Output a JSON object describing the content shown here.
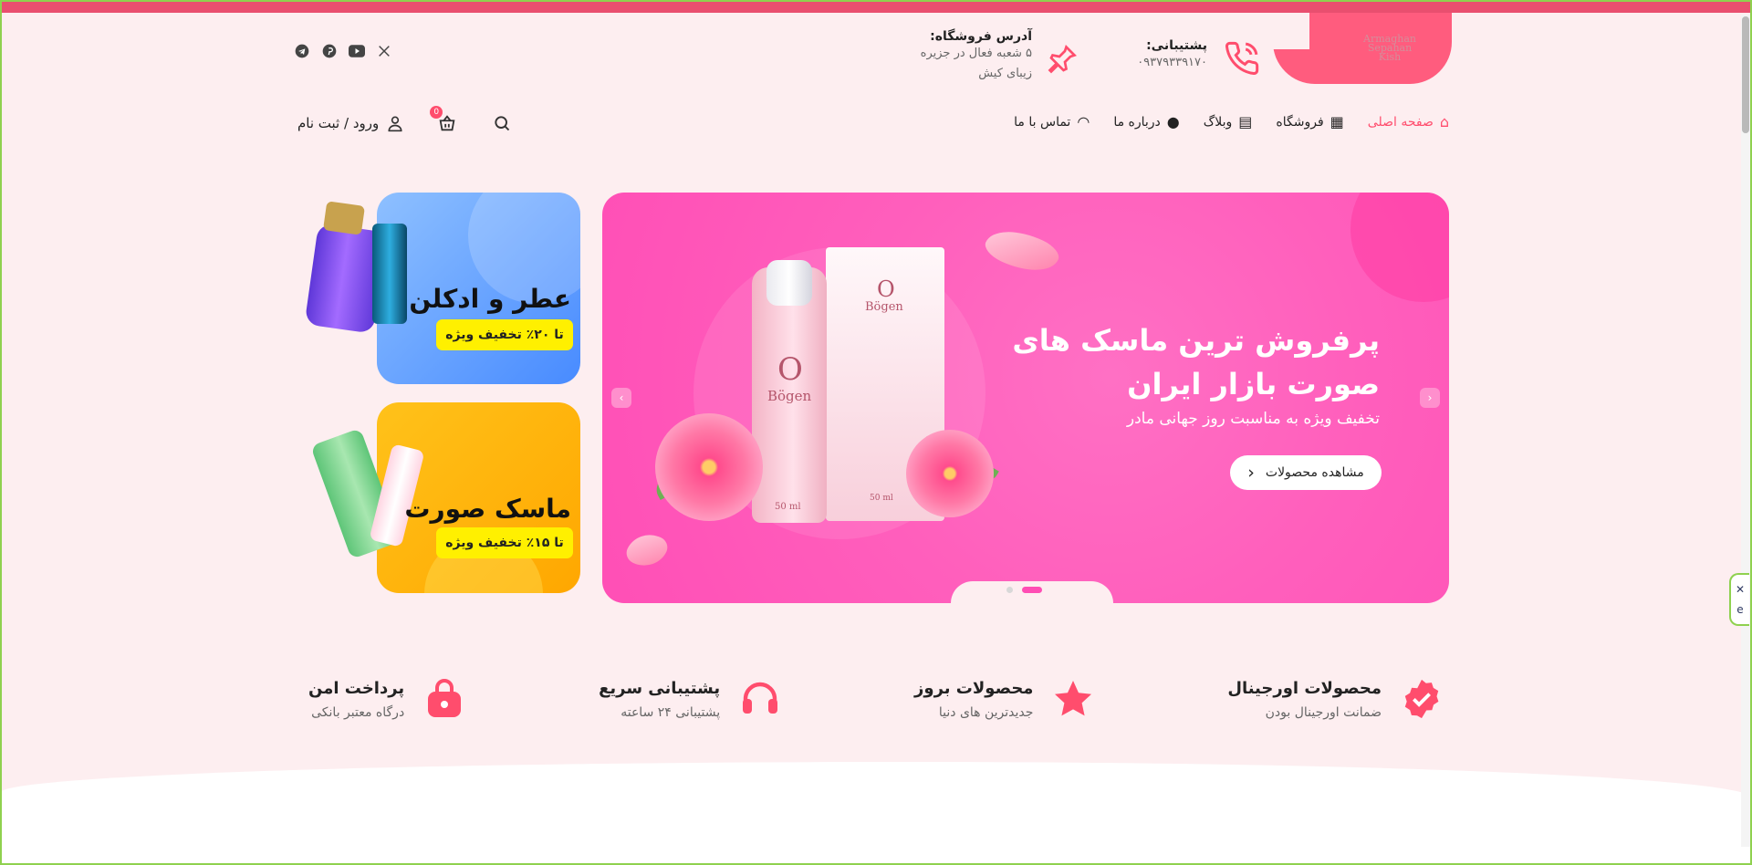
{
  "theme": {
    "accent": "#ff4d6d",
    "background": "#fdeef0",
    "hero": "#ff5fbc",
    "perfume_card": "#6fa8ff",
    "mask_card": "#ffb300",
    "discount_badge": "#fff000"
  },
  "header": {
    "logo_text_line1": "Armaghan",
    "logo_text_line2": "Sepahan",
    "logo_text_line3": "Kish",
    "support": {
      "title": "پشتیبانی:",
      "phone": "۰۹۳۷۹۳۳۹۱۷۰"
    },
    "address": {
      "title": "آدرس فروشگاه:",
      "line1": "۵ شعبه فعال در جزیره",
      "line2": "زیبای کیش"
    },
    "social_icons": [
      "x-icon",
      "youtube-icon",
      "pinterest-icon",
      "telegram-icon"
    ]
  },
  "nav": {
    "home": "صفحه اصلی",
    "shop": "فروشگاه",
    "blog": "وبلاگ",
    "about": "درباره ما",
    "contact": "تماس با ما"
  },
  "user": {
    "login": "ورود / ثبت نام",
    "cart_count": "0"
  },
  "hero": {
    "title_line1": "پرفروش ترین ماسک های",
    "title_line2": "صورت بازار ایران",
    "subtitle": "تخفیف ویژه به مناسبت روز جهانی مادر",
    "cta": "مشاهده محصولات",
    "product_brand": "Bögen",
    "product_letter": "O",
    "product_volume": "50 ml"
  },
  "side_cards": {
    "perfume": {
      "title": "عطر و ادکلن",
      "badge": "تا ۲۰٪ تخفیف ویژه"
    },
    "mask": {
      "title": "ماسک صورت",
      "badge": "تا ۱۵٪ تخفیف ویژه"
    }
  },
  "features": [
    {
      "icon": "verified-badge-icon",
      "title": "محصولات اورجینال",
      "text": "ضمانت اورجینال بودن"
    },
    {
      "icon": "star-icon",
      "title": "محصولات بروز",
      "text": "جدیدترین های دنیا"
    },
    {
      "icon": "headset-icon",
      "title": "پشتیبانی سریع",
      "text": "پشتیبانی ۲۴ ساعته"
    },
    {
      "icon": "secure-bag-icon",
      "title": "پرداخت امن",
      "text": "درگاه معتبر بانکی"
    }
  ]
}
